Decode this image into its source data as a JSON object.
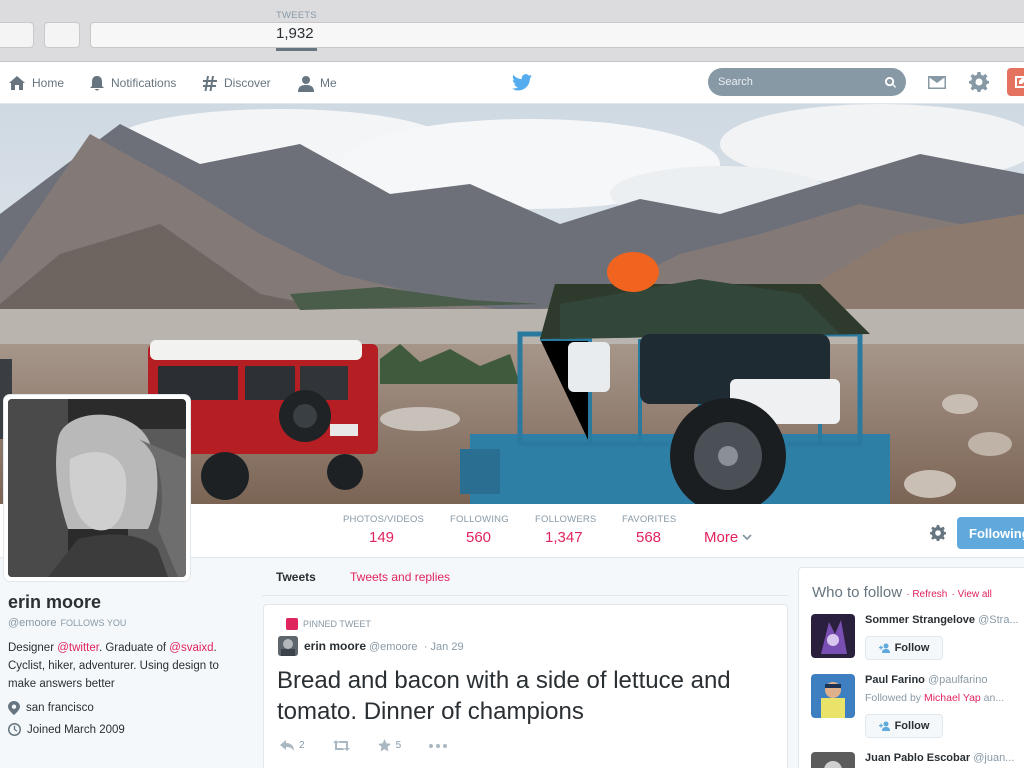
{
  "nav": {
    "home": "Home",
    "notifications": "Notifications",
    "discover": "Discover",
    "me": "Me",
    "search_placeholder": "Search"
  },
  "stats": [
    {
      "label": "TWEETS",
      "value": "1,932"
    },
    {
      "label": "PHOTOS/VIDEOS",
      "value": "149"
    },
    {
      "label": "FOLLOWING",
      "value": "560"
    },
    {
      "label": "FOLLOWERS",
      "value": "1,347"
    },
    {
      "label": "FAVORITES",
      "value": "568"
    }
  ],
  "more_label": "More",
  "following_label": "Following",
  "profile": {
    "name": "erin moore",
    "handle": "@emoore",
    "follows_you": "FOLLOWS YOU",
    "bio_1": "Designer ",
    "bio_mention_1": "@twitter",
    "bio_2": ". Graduate of ",
    "bio_mention_2": "@svaixd",
    "bio_3": ". Cyclist, hiker, adventurer. Using design to make answers better",
    "location": "san francisco",
    "joined": "Joined March 2009"
  },
  "tabs": {
    "tweets": "Tweets",
    "tweets_replies": "Tweets and replies"
  },
  "tweet": {
    "pinned": "PINNED TWEET",
    "author": "erin moore",
    "handle": "@emoore",
    "date": "· Jan 29",
    "text": "Bread and bacon with a side of lettuce and tomato. Dinner of champions",
    "replies": "2",
    "favorites": "5"
  },
  "who_to_follow": {
    "title": "Who to follow",
    "refresh": "· Refresh",
    "view_all": "· View all",
    "follow_label": "Follow",
    "users": [
      {
        "name": "Sommer Strangelove",
        "handle": "@Stra..."
      },
      {
        "name": "Paul Farino",
        "handle": "@paulfarino",
        "followed_by_prefix": "Followed by ",
        "followed_by": "Michael Yap",
        "followed_by_suffix": " an..."
      },
      {
        "name": "Juan Pablo Escobar",
        "handle": "@juan..."
      }
    ]
  },
  "colors": {
    "accent_red": "#e0245e",
    "twitter_blue": "#55acee",
    "following_button": "#5fa9dd"
  }
}
